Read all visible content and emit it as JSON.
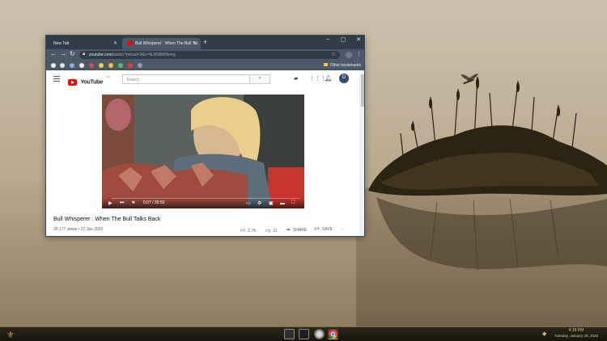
{
  "browser": {
    "tabs": [
      {
        "label": "New Tab",
        "active": false
      },
      {
        "label": "Bull Whisperer : When The Bull Tal",
        "active": true
      }
    ],
    "new_tab_symbol": "+",
    "window_controls": {
      "minimize": "–",
      "maximize": "▢",
      "close": "✕"
    },
    "address": {
      "host": "youtube.com",
      "path": "/watch?reload=9&v=9LB5lBbfNeeg"
    },
    "bookmarks_other": "Other bookmarks",
    "profile_initial": "D"
  },
  "youtube": {
    "logo_word": "YouTube",
    "logo_region": "CA",
    "search_placeholder": "Search",
    "avatar_initial": "D",
    "video": {
      "title": "Bull Whisperer : When The Bull Talks Back",
      "views_date": "26,177 views • 27 Jan 2020",
      "time_display": "0:07 / 30:50",
      "progress_fraction": 0.004
    },
    "actions": {
      "likes": "2.7K",
      "dislikes": "21",
      "share": "SHARE",
      "save": "SAVE",
      "more": "···"
    }
  },
  "taskbar": {
    "clock_time": "4:18 PM",
    "clock_date": "Tuesday, January 28, 2020"
  },
  "colors": {
    "chrome_frame": "#2e3d48",
    "chrome_toolbar": "#4b5a66",
    "yt_red": "#ff0000",
    "taskbar_accent": "#cfa84a"
  }
}
